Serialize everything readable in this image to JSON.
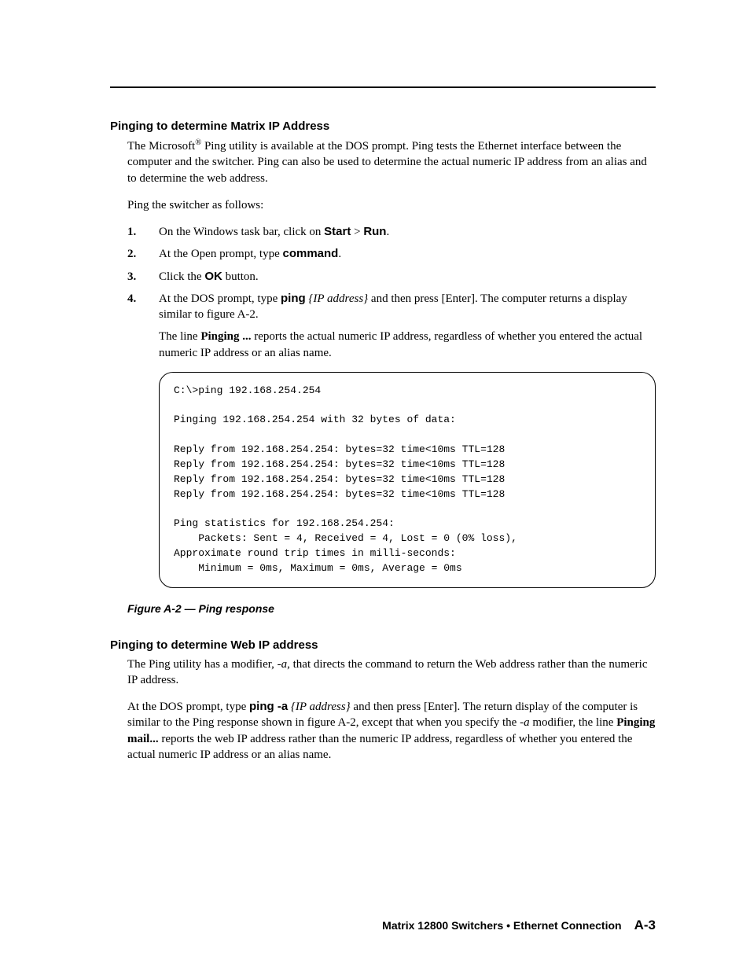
{
  "section1": {
    "heading": "Pinging to determine Matrix IP Address",
    "para1_a": "The Microsoft",
    "para1_sup": "®",
    "para1_b": " Ping utility is available at the DOS prompt.  Ping tests the Ethernet interface between the computer and the switcher.  Ping can also be used to determine the actual numeric IP address from an alias and to determine the web address.",
    "para2": "Ping the switcher as follows:",
    "steps": {
      "1": {
        "num": "1",
        "a": "On the Windows task bar, click on ",
        "b": "Start",
        "c": " > ",
        "d": "Run",
        "e": "."
      },
      "2": {
        "num": "2",
        "a": "At the Open prompt, type ",
        "b": "command",
        "c": "."
      },
      "3": {
        "num": "3",
        "a": "Click the ",
        "b": "OK",
        "c": " button."
      },
      "4": {
        "num": "4",
        "a": "At the DOS prompt, type ",
        "b": "ping",
        "c": " ",
        "d": "{IP address}",
        "e": " and then press [Enter].  The computer returns a display similar to figure A-2."
      }
    },
    "sub_a": "The line ",
    "sub_b": "Pinging ...",
    "sub_c": " reports the actual numeric IP address, regardless of whether you entered the actual numeric IP address or an alias name.",
    "code": "C:\\>ping 192.168.254.254\n\nPinging 192.168.254.254 with 32 bytes of data:\n\nReply from 192.168.254.254: bytes=32 time<10ms TTL=128\nReply from 192.168.254.254: bytes=32 time<10ms TTL=128\nReply from 192.168.254.254: bytes=32 time<10ms TTL=128\nReply from 192.168.254.254: bytes=32 time<10ms TTL=128\n\nPing statistics for 192.168.254.254:\n    Packets: Sent = 4, Received = 4, Lost = 0 (0% loss),\nApproximate round trip times in milli-seconds:\n    Minimum = 0ms, Maximum = 0ms, Average = 0ms",
    "fig_caption": "Figure A-2 — Ping response"
  },
  "section2": {
    "heading": "Pinging to determine Web IP address",
    "para1_a": "The Ping utility has a modifier, ",
    "para1_b": "-a",
    "para1_c": ", that directs the command to return the Web address rather than the numeric IP address.",
    "para2_a": "At the DOS prompt, type ",
    "para2_b": "ping -a",
    "para2_c": " ",
    "para2_d": "{IP address}",
    "para2_e": " and then press [Enter].  The return display of the computer is similar to the Ping response shown in figure A-2, except that when you specify the ",
    "para2_f": "-a",
    "para2_g": " modifier, the line ",
    "para2_h": "Pinging mail...",
    "para2_i": " reports the web IP address rather than the numeric IP address, regardless of whether you entered the actual numeric IP address or an alias name."
  },
  "footer": {
    "text": "Matrix 12800 Switchers • Ethernet Connection",
    "page": "A-3"
  }
}
